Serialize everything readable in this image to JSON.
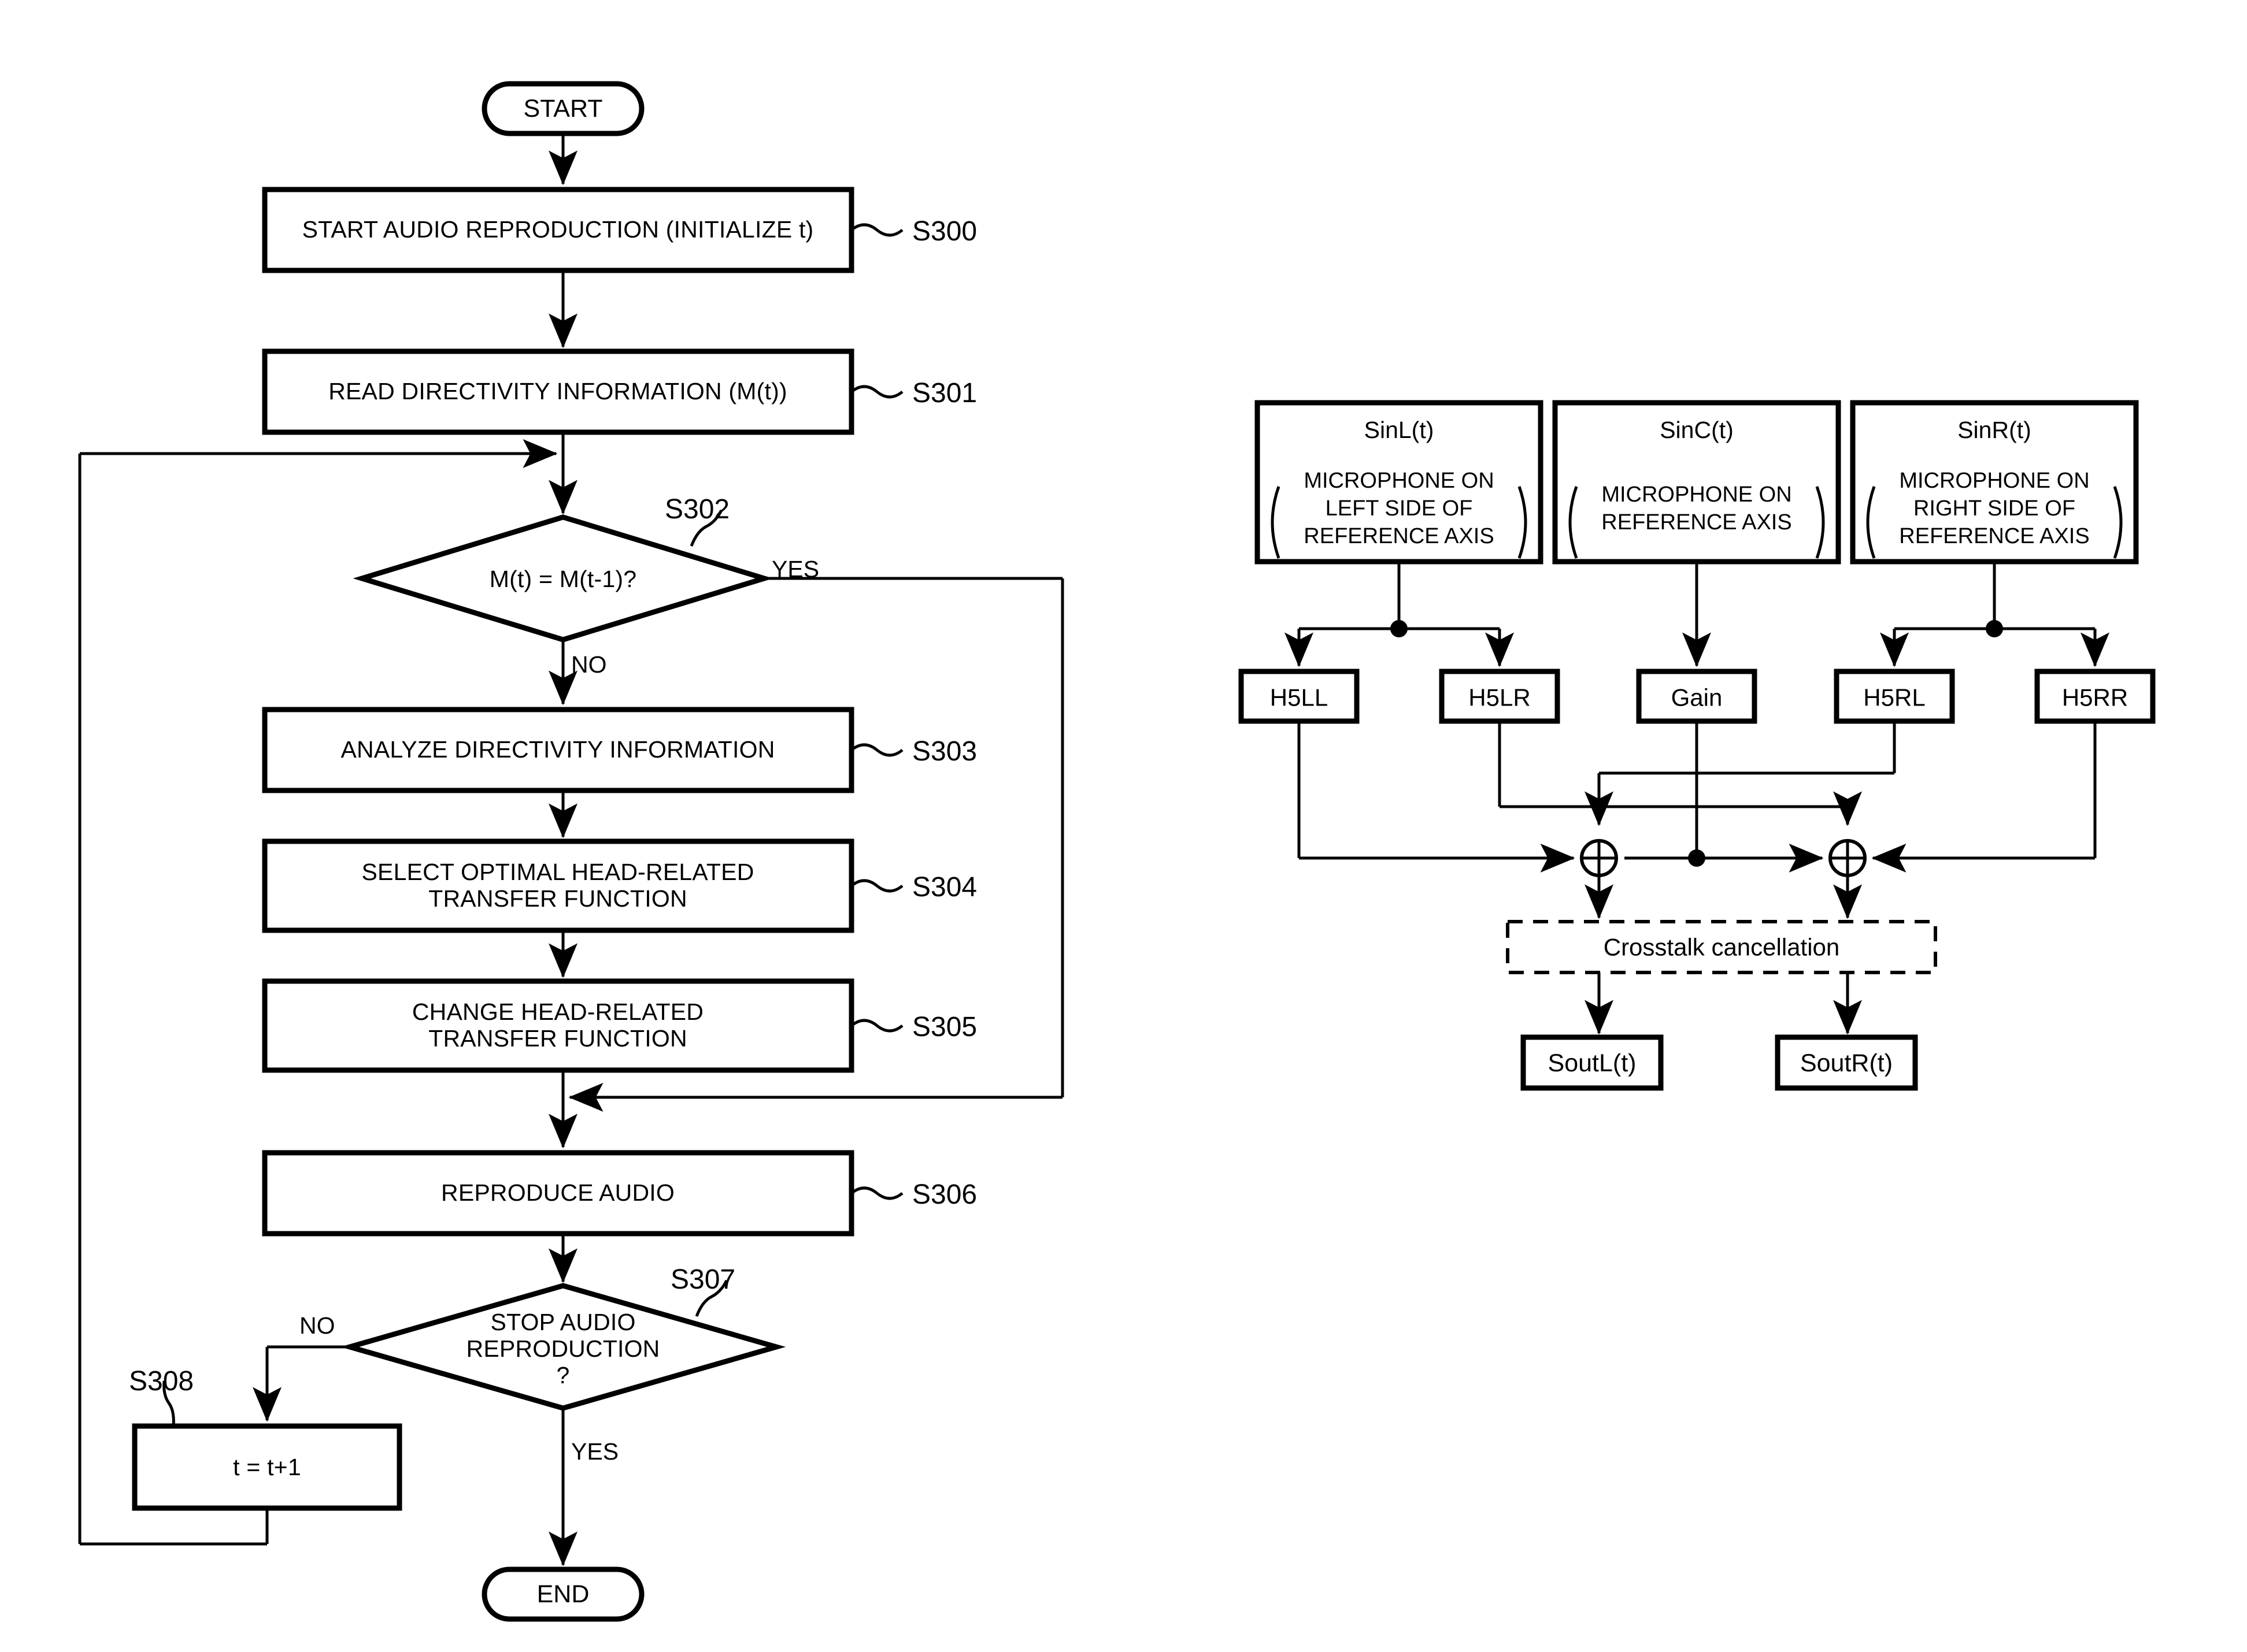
{
  "figure": {
    "type": "patent-flowchart-and-block-diagram",
    "background_color": "#ffffff",
    "line_color": "#000000"
  },
  "flowchart": {
    "terminals": {
      "start": "START",
      "end": "END"
    },
    "steps": [
      {
        "id": "S300",
        "tag": "S300",
        "text": "START AUDIO REPRODUCTION (INITIALIZE t)",
        "shape": "process"
      },
      {
        "id": "S301",
        "tag": "S301",
        "text": "READ DIRECTIVITY INFORMATION (M(t))",
        "shape": "process"
      },
      {
        "id": "S302",
        "tag": "S302",
        "text": "M(t) = M(t-1)?",
        "shape": "decision"
      },
      {
        "id": "S303",
        "tag": "S303",
        "text": "ANALYZE DIRECTIVITY INFORMATION",
        "shape": "process"
      },
      {
        "id": "S304",
        "tag": "S304",
        "text": "SELECT OPTIMAL HEAD-RELATED\nTRANSFER FUNCTION",
        "shape": "process"
      },
      {
        "id": "S305",
        "tag": "S305",
        "text": "CHANGE HEAD-RELATED\nTRANSFER FUNCTION",
        "shape": "process"
      },
      {
        "id": "S306",
        "tag": "S306",
        "text": "REPRODUCE AUDIO",
        "shape": "process"
      },
      {
        "id": "S307",
        "tag": "S307",
        "text": "STOP AUDIO\nREPRODUCTION\n?",
        "shape": "decision"
      },
      {
        "id": "S308",
        "tag": "S308",
        "text": "t = t+1",
        "shape": "process"
      }
    ],
    "branch_labels": {
      "s302_yes": "YES",
      "s302_no": "NO",
      "s307_no": "NO",
      "s307_yes": "YES"
    }
  },
  "block_diagram": {
    "inputs": [
      {
        "id": "SinL",
        "title": "SinL(t)",
        "desc_line1": "MICROPHONE ON",
        "desc_line2": "LEFT SIDE OF",
        "desc_line3": "REFERENCE AXIS"
      },
      {
        "id": "SinC",
        "title": "SinC(t)",
        "desc_line1": "MICROPHONE ON",
        "desc_line2": "REFERENCE AXIS",
        "desc_line3": ""
      },
      {
        "id": "SinR",
        "title": "SinR(t)",
        "desc_line1": "MICROPHONE ON",
        "desc_line2": "RIGHT SIDE OF",
        "desc_line3": "REFERENCE AXIS"
      }
    ],
    "filters": [
      {
        "id": "H5LL",
        "label": "H5LL"
      },
      {
        "id": "H5LR",
        "label": "H5LR"
      },
      {
        "id": "Gain",
        "label": "Gain"
      },
      {
        "id": "H5RL",
        "label": "H5RL"
      },
      {
        "id": "H5RR",
        "label": "H5RR"
      }
    ],
    "processing": {
      "id": "crosstalk",
      "label": "Crosstalk cancellation",
      "border": "dashed"
    },
    "outputs": [
      {
        "id": "SoutL",
        "label": "SoutL(t)"
      },
      {
        "id": "SoutR",
        "label": "SoutR(t)"
      }
    ],
    "summing_nodes": [
      {
        "id": "sum-left",
        "symbol": "+"
      },
      {
        "id": "sum-right",
        "symbol": "+"
      }
    ]
  }
}
